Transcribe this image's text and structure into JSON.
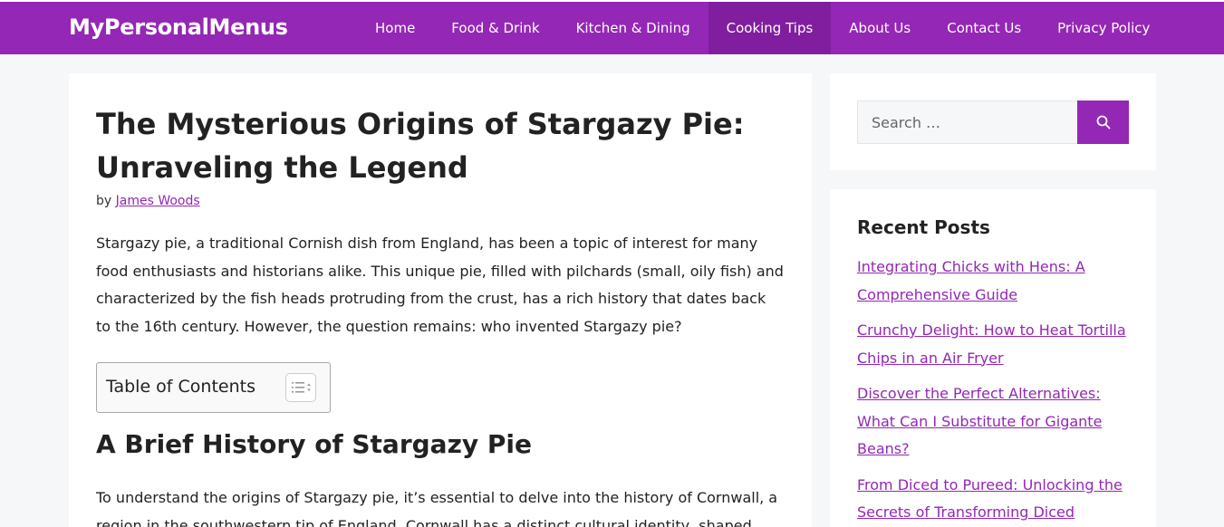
{
  "site": {
    "title": "MyPersonalMenus",
    "brand_color": "#9427b5",
    "active_nav_color": "#801e9f"
  },
  "nav": {
    "items": [
      {
        "label": "Home"
      },
      {
        "label": "Food & Drink"
      },
      {
        "label": "Kitchen & Dining"
      },
      {
        "label": "Cooking Tips",
        "active": true
      },
      {
        "label": "About Us"
      },
      {
        "label": "Contact Us"
      },
      {
        "label": "Privacy Policy"
      }
    ]
  },
  "article": {
    "title": "The Mysterious Origins of Stargazy Pie: Unraveling the Legend",
    "byline_prefix": "by",
    "author": "James Woods",
    "intro": "Stargazy pie, a traditional Cornish dish from England, has been a topic of interest for many food enthusiasts and historians alike. This unique pie, filled with pilchards (small, oily fish) and characterized by the fish heads protruding from the crust, has a rich history that dates back to the 16th century. However, the question remains: who invented Stargazy pie?",
    "toc_title": "Table of Contents",
    "toc_icon": "list-toggle-icon",
    "section_heading": "A Brief History of Stargazy Pie",
    "section_paragraph": "To understand the origins of Stargazy pie, it’s essential to delve into the history of Cornwall, a region in the southwestern tip of England. Cornwall has a distinct cultural identity, shaped"
  },
  "sidebar": {
    "search": {
      "placeholder": "Search …",
      "button_icon": "search-icon"
    },
    "recent_posts": {
      "title": "Recent Posts",
      "items": [
        {
          "label": "Integrating Chicks with Hens: A Comprehensive Guide"
        },
        {
          "label": "Crunchy Delight: How to Heat Tortilla Chips in an Air Fryer"
        },
        {
          "label": "Discover the Perfect Alternatives: What Can I Substitute for Gigante Beans?"
        },
        {
          "label": "From Diced to Pureed: Unlocking the Secrets of Transforming Diced"
        }
      ]
    }
  }
}
